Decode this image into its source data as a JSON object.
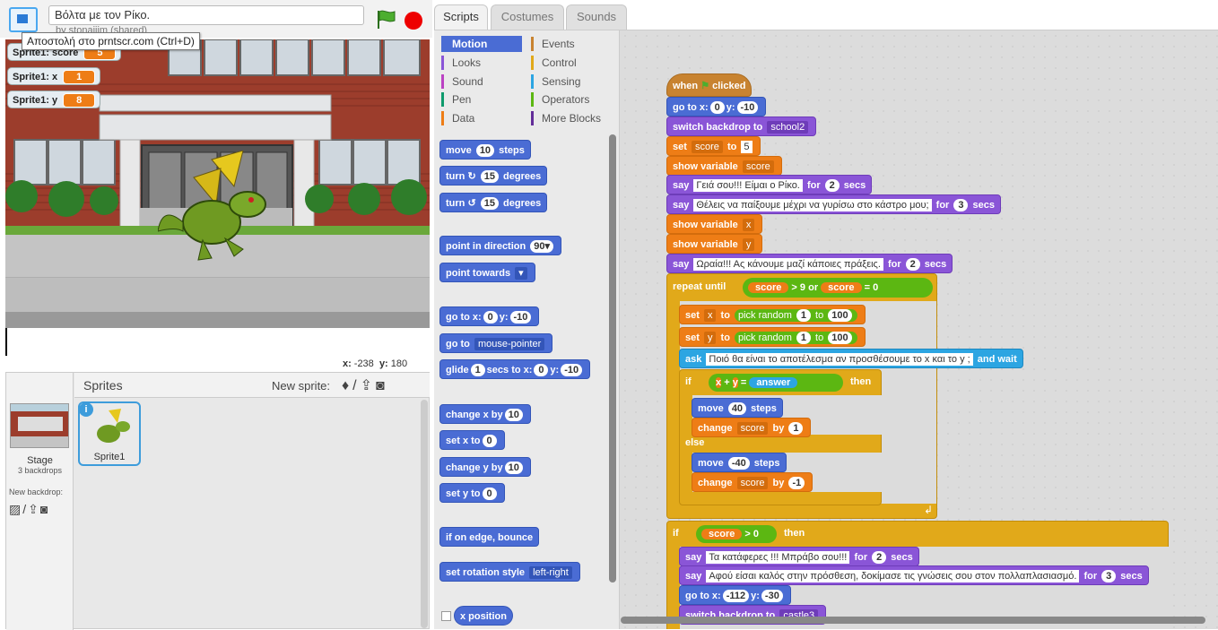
{
  "project": {
    "title": "Βόλτα με τον Ρίκο.",
    "author": "by stonaijim (shared)"
  },
  "tooltip": "Αποστολή στο prntscr.com (Ctrl+D)",
  "monitors": [
    {
      "label": "Sprite1: score",
      "value": "5"
    },
    {
      "label": "Sprite1: x",
      "value": "1"
    },
    {
      "label": "Sprite1: y",
      "value": "8"
    }
  ],
  "stage_coords": {
    "x_label": "x:",
    "x": "-238",
    "y_label": "y:",
    "y": "180"
  },
  "sprites_pane": {
    "title": "Sprites",
    "new_sprite_label": "New sprite:",
    "stage_label": "Stage",
    "backdrops": "3 backdrops",
    "new_backdrop_label": "New backdrop:",
    "sprite_name": "Sprite1",
    "info_badge": "i"
  },
  "tabs": [
    "Scripts",
    "Costumes",
    "Sounds"
  ],
  "categories": {
    "left": [
      {
        "label": "Motion",
        "color": "#4a6cd4"
      },
      {
        "label": "Looks",
        "color": "#8a55d7"
      },
      {
        "label": "Sound",
        "color": "#bb42c3"
      },
      {
        "label": "Pen",
        "color": "#0e9a6c"
      },
      {
        "label": "Data",
        "color": "#ee7d16"
      }
    ],
    "right": [
      {
        "label": "Events",
        "color": "#c88330"
      },
      {
        "label": "Control",
        "color": "#e1a91a"
      },
      {
        "label": "Sensing",
        "color": "#2ca5e2"
      },
      {
        "label": "Operators",
        "color": "#5cb712"
      },
      {
        "label": "More Blocks",
        "color": "#632d99"
      }
    ]
  },
  "palette": {
    "move": "move",
    "move_n": "10",
    "steps": "steps",
    "turn": "turn",
    "turn_n": "15",
    "degrees": "degrees",
    "point_dir": "point in direction",
    "point_dir_n": "90▾",
    "point_towards": "point towards",
    "goto_xy": "go to x:",
    "goto_x": "0",
    "y": "y:",
    "goto_y": "-10",
    "goto": "go to",
    "goto_target": "mouse-pointer",
    "glide": "glide",
    "glide_n": "1",
    "glide_secs": "secs to x:",
    "glide_x": "0",
    "glide_y": "-10",
    "change_x": "change x by",
    "change_x_n": "10",
    "set_x": "set x to",
    "set_x_n": "0",
    "change_y": "change y by",
    "change_y_n": "10",
    "set_y": "set y to",
    "set_y_n": "0",
    "bounce": "if on edge, bounce",
    "rot_style": "set rotation style",
    "rot_style_v": "left-right",
    "x_position": "x position"
  },
  "script": {
    "when": "when",
    "clicked": "clicked",
    "goto": "go to x:",
    "goto_x": "0",
    "y": "y:",
    "goto_y": "-10",
    "switch_backdrop": "switch backdrop to",
    "backdrop1": "school2",
    "set": "set",
    "score": "score",
    "to": "to",
    "five": "5",
    "show_variable": "show variable",
    "say": "say",
    "for": "for",
    "secs": "secs",
    "say1": "Γειά σου!!! Είμαι ο Ρίκο.",
    "say1_n": "2",
    "say2": "Θέλεις να παίξουμε μέχρι να γυρίσω στο κάστρο μου;",
    "say2_n": "3",
    "x": "x",
    "yv": "y",
    "say3": "Ωραία!!! Ας κάνουμε μαζί κάποιες πράξεις.",
    "say3_n": "2",
    "repeat_until": "repeat until",
    "gt": ">",
    "nine": "9",
    "or": "or",
    "eq": "=",
    "zero": "0",
    "pick_random": "pick random",
    "r1": "1",
    "r100": "100",
    "ask": "ask",
    "ask_q": "Ποιό θα είναι το αποτέλεσμα αν προσθέσουμε το x και το y ;",
    "and_wait": "and wait",
    "if": "if",
    "then": "then",
    "plus": "+",
    "answer": "answer",
    "move": "move",
    "steps": "steps",
    "m40": "40",
    "mm40": "-40",
    "change": "change",
    "by": "by",
    "one": "1",
    "mone": "-1",
    "else": "else",
    "say4": "Τα κατάφερες !!! Μπράβο σου!!!",
    "say4_n": "2",
    "say5": "Αφού είσαι καλός στην πρόσθεση, δοκίμασε τις γνώσεις σου στον πολλαπλασιασμό.",
    "say5_n": "3",
    "goto2_x": "-112",
    "goto2_y": "-30",
    "backdrop2": "castle3"
  }
}
